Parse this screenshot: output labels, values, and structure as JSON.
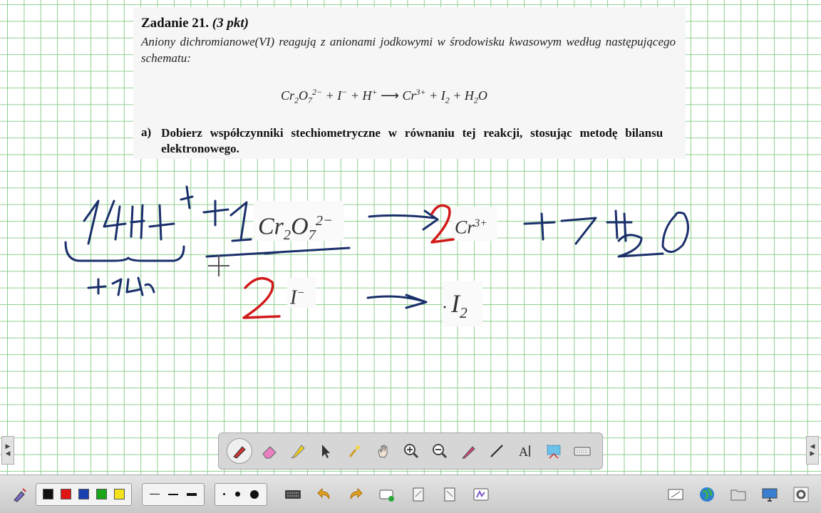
{
  "task": {
    "title": "Zadanie 21.",
    "points": "(3 pkt)",
    "intro": "Aniony dichromianowe(VI) reagują z anionami jodkowymi w środowisku kwasowym według następującego schematu:",
    "equation": {
      "cr2o7": "Cr",
      "cr_sub": "2",
      "o": "O",
      "o_sub": "7",
      "cr2o7_charge": "2−",
      "iodide": "I",
      "iodide_charge": "−",
      "proton": "H",
      "proton_charge": "+",
      "arrow": "⟶",
      "plus": "+",
      "cr3": "Cr",
      "cr3_charge": "3+",
      "iodine": "I",
      "iodine_sub": "2",
      "water_h": "H",
      "water_sub": "2",
      "water_o": "O"
    },
    "part_a_label": "a)",
    "part_a_text": "Dobierz współczynniki stechiometryczne w równaniu tej reakcji, stosując metodę bilansu elektronowego."
  },
  "pasted": {
    "dichromate": {
      "cr": "Cr",
      "cr_sub": "2",
      "o": "O",
      "o_sub": "7",
      "charge": "2−"
    },
    "chromium": {
      "cr": "Cr",
      "charge": "3+"
    },
    "iodide": {
      "i": "I",
      "charge": "−"
    },
    "iodine": {
      "i": "I",
      "sub": "2"
    }
  },
  "ink_colors": {
    "blue": "#1a2f6b",
    "red": "#d11a1a"
  },
  "floating_toolbar": [
    "pen-icon",
    "eraser-icon",
    "highlighter-icon",
    "select-arrow-icon",
    "magic-pen-icon",
    "hand-pan-icon",
    "zoom-in-icon",
    "zoom-out-icon",
    "creative-pen-icon",
    "line-icon",
    "text-icon",
    "screen-capture-icon",
    "keyboard-icon"
  ],
  "bottom_bar": {
    "colors": [
      "#111111",
      "#e01515",
      "#1a3fb0",
      "#1aa51a",
      "#f4e21a"
    ],
    "line_widths": [
      1,
      2,
      4
    ],
    "dot_sizes": [
      3,
      7,
      12
    ]
  }
}
